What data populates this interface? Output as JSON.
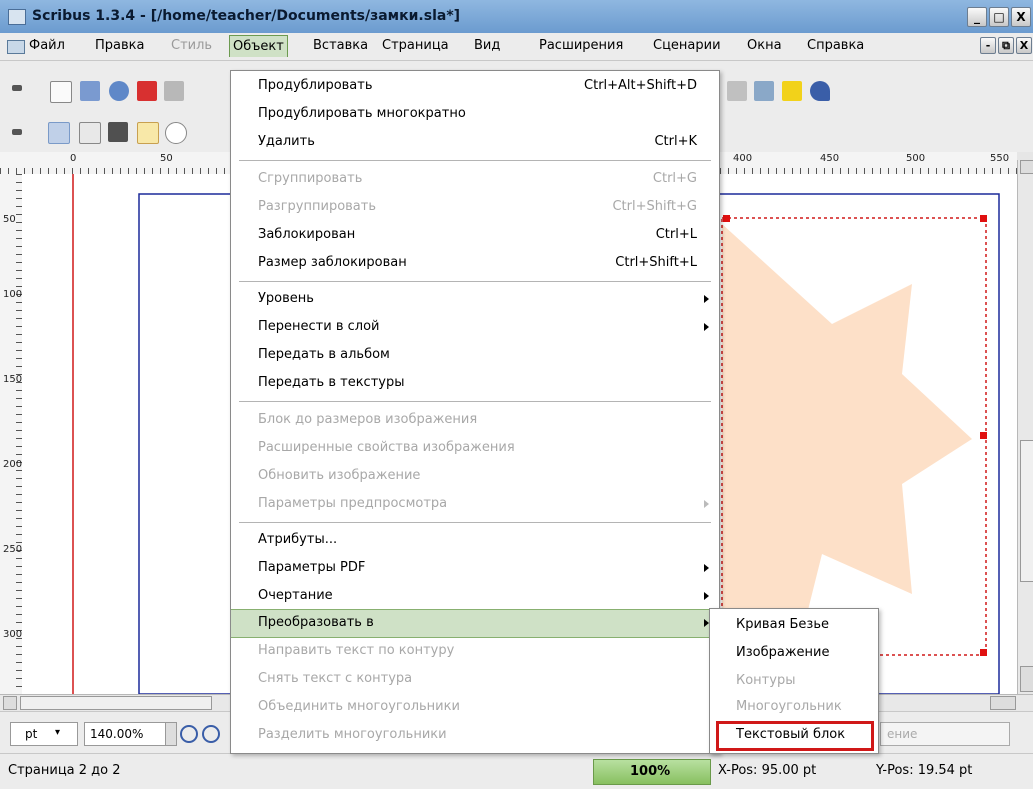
{
  "window": {
    "title": "Scribus 1.3.4 - [/home/teacher/Documents/замки.sla*]",
    "controls": [
      "_",
      "□",
      "X"
    ]
  },
  "menubar": {
    "items": [
      {
        "label": "Файл"
      },
      {
        "label": "Правка"
      },
      {
        "label": "Стиль"
      },
      {
        "label": "Объект"
      },
      {
        "label": "Вставка"
      },
      {
        "label": "Страница"
      },
      {
        "label": "Вид"
      },
      {
        "label": "Расширения"
      },
      {
        "label": "Сценарии"
      },
      {
        "label": "Окна"
      },
      {
        "label": "Справка"
      }
    ],
    "doc_controls": [
      "-",
      "⧉",
      "X"
    ]
  },
  "rulers": {
    "h_ticks": [
      "0",
      "50",
      "400",
      "450",
      "500",
      "550"
    ],
    "v_ticks": [
      "50",
      "100",
      "150",
      "200",
      "250",
      "300"
    ]
  },
  "object_menu": {
    "items": [
      {
        "label": "Продублировать",
        "shortcut": "Ctrl+Alt+Shift+D",
        "enabled": true
      },
      {
        "label": "Продублировать многократно",
        "shortcut": "",
        "enabled": true
      },
      {
        "label": "Удалить",
        "shortcut": "Ctrl+K",
        "enabled": true
      },
      {
        "label": "Сгруппировать",
        "shortcut": "Ctrl+G",
        "enabled": false
      },
      {
        "label": "Разгруппировать",
        "shortcut": "Ctrl+Shift+G",
        "enabled": false
      },
      {
        "label": "Заблокирован",
        "shortcut": "Ctrl+L",
        "enabled": true
      },
      {
        "label": "Размер заблокирован",
        "shortcut": "Ctrl+Shift+L",
        "enabled": true
      },
      {
        "label": "Уровень",
        "shortcut": "",
        "enabled": true,
        "submenu": true
      },
      {
        "label": "Перенести в слой",
        "shortcut": "",
        "enabled": true,
        "submenu": true
      },
      {
        "label": "Передать в альбом",
        "shortcut": "",
        "enabled": true
      },
      {
        "label": "Передать в текстуры",
        "shortcut": "",
        "enabled": true
      },
      {
        "label": "Блок до размеров изображения",
        "shortcut": "",
        "enabled": false
      },
      {
        "label": "Расширенные свойства изображения",
        "shortcut": "",
        "enabled": false
      },
      {
        "label": "Обновить изображение",
        "shortcut": "",
        "enabled": false
      },
      {
        "label": "Параметры предпросмотра",
        "shortcut": "",
        "enabled": false,
        "submenu": true
      },
      {
        "label": "Атрибуты...",
        "shortcut": "",
        "enabled": true
      },
      {
        "label": "Параметры PDF",
        "shortcut": "",
        "enabled": true,
        "submenu": true
      },
      {
        "label": "Очертание",
        "shortcut": "",
        "enabled": true,
        "submenu": true
      },
      {
        "label": "Преобразовать в",
        "shortcut": "",
        "enabled": true,
        "submenu": true,
        "highlighted": true
      },
      {
        "label": "Направить текст по контуру",
        "shortcut": "",
        "enabled": false
      },
      {
        "label": "Снять текст с контура",
        "shortcut": "",
        "enabled": false
      },
      {
        "label": "Объединить многоугольники",
        "shortcut": "",
        "enabled": false
      },
      {
        "label": "Разделить многоугольники",
        "shortcut": "",
        "enabled": false
      }
    ]
  },
  "convert_submenu": {
    "items": [
      {
        "label": "Кривая Безье",
        "enabled": true
      },
      {
        "label": "Изображение",
        "enabled": true
      },
      {
        "label": "Контуры",
        "enabled": false
      },
      {
        "label": "Многоугольник",
        "enabled": false
      },
      {
        "label": "Текстовый блок",
        "enabled": true,
        "boxed": true
      }
    ]
  },
  "bottombar": {
    "unit": "pt",
    "zoom": "140.00%",
    "layer_hint": "ение"
  },
  "statusbar": {
    "page": "Страница 2 до 2",
    "progress": "100%",
    "xpos": "X-Pos: 95.00 pt",
    "ypos": "Y-Pos: 19.54 pt"
  },
  "colors": {
    "menu_highlight": "#cfe1c6",
    "star_fill": "#fde0c8",
    "frame_handles": "#e01010",
    "page_border": "#1c2a9a",
    "margin_line": "#d01818",
    "callout_box": "#d01818"
  }
}
